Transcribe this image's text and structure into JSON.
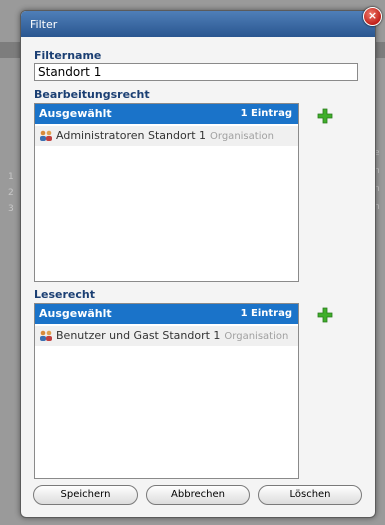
{
  "dialog": {
    "title": "Filter",
    "close_label": "×"
  },
  "filtername": {
    "label": "Filtername",
    "value": "Standort 1"
  },
  "bearbeitungsrecht": {
    "label": "Bearbeitungsrecht",
    "header_left": "Ausgewählt",
    "header_right": "1 Eintrag",
    "items": [
      {
        "name": "Administratoren Standort 1",
        "type": "Organisation",
        "icon": "group-icon"
      }
    ]
  },
  "leserecht": {
    "label": "Leserecht",
    "header_left": "Ausgewählt",
    "header_right": "1 Eintrag",
    "items": [
      {
        "name": "Benutzer und Gast Standort 1",
        "type": "Organisation",
        "icon": "group-icon"
      }
    ]
  },
  "buttons": {
    "save": "Speichern",
    "cancel": "Abbrechen",
    "delete": "Löschen"
  },
  "background": {
    "row_numbers": [
      "1",
      "2",
      "3"
    ],
    "right_fragments": [
      "e",
      "n",
      "n",
      "n"
    ]
  },
  "colors": {
    "title_bar": "#2a5690",
    "list_header": "#1a73c9",
    "section_label": "#1b3f73",
    "add_icon": "#3fae2a"
  }
}
